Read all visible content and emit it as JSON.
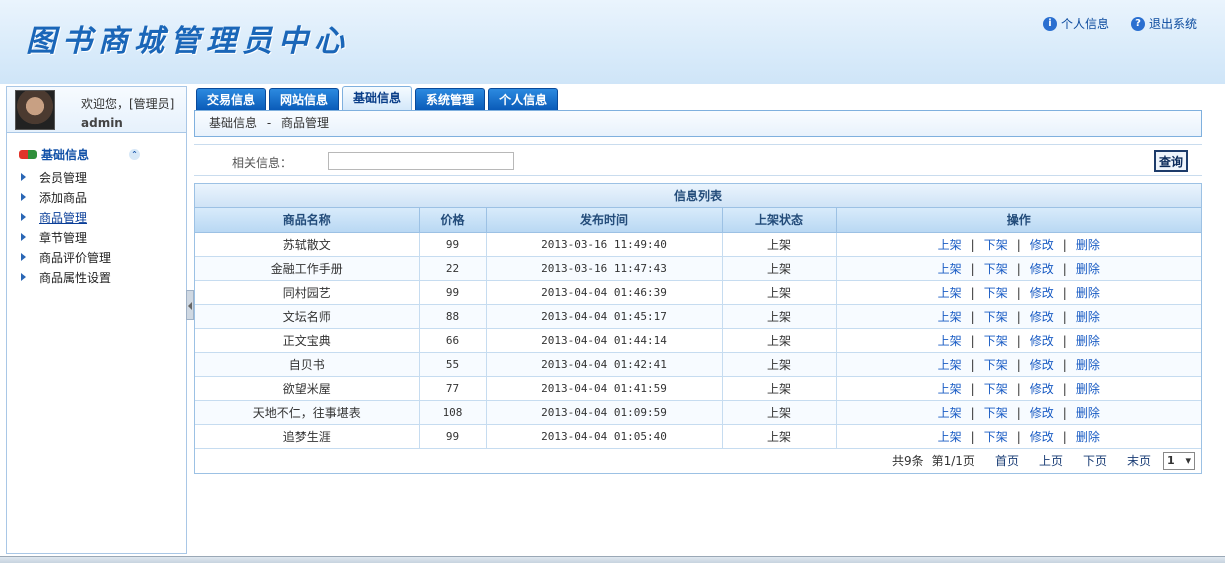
{
  "header": {
    "logo": "图书商城管理员中心",
    "links": [
      {
        "label": "个人信息",
        "icon": "info-icon"
      },
      {
        "label": "退出系统",
        "icon": "help-icon"
      }
    ]
  },
  "user": {
    "welcome": "欢迎您，[管理员]",
    "name": "admin"
  },
  "sidebar": {
    "section": "基础信息",
    "items": [
      {
        "label": "会员管理"
      },
      {
        "label": "添加商品"
      },
      {
        "label": "商品管理"
      },
      {
        "label": "章节管理"
      },
      {
        "label": "商品评价管理"
      },
      {
        "label": "商品属性设置"
      }
    ]
  },
  "tabs": [
    {
      "label": "交易信息"
    },
    {
      "label": "网站信息"
    },
    {
      "label": "基础信息"
    },
    {
      "label": "系统管理"
    },
    {
      "label": "个人信息"
    }
  ],
  "breadcrumb": {
    "a": "基础信息",
    "sep": "-",
    "b": "商品管理"
  },
  "search": {
    "label": "相关信息：",
    "value": "",
    "button": "查询"
  },
  "table": {
    "title": "信息列表",
    "headers": [
      "商品名称",
      "价格",
      "发布时间",
      "上架状态",
      "操作"
    ],
    "rows": [
      [
        "苏轼散文",
        "99",
        "2013-03-16 11:49:40",
        "上架"
      ],
      [
        "金融工作手册",
        "22",
        "2013-03-16 11:47:43",
        "上架"
      ],
      [
        "同村园艺",
        "99",
        "2013-04-04 01:46:39",
        "上架"
      ],
      [
        "文坛名师",
        "88",
        "2013-04-04 01:45:17",
        "上架"
      ],
      [
        "正文宝典",
        "66",
        "2013-04-04 01:44:14",
        "上架"
      ],
      [
        "自贝书",
        "55",
        "2013-04-04 01:42:41",
        "上架"
      ],
      [
        "欲望米屋",
        "77",
        "2013-04-04 01:41:59",
        "上架"
      ],
      [
        "天地不仁，往事堪表",
        "108",
        "2013-04-04 01:09:59",
        "上架"
      ],
      [
        "追梦生涯",
        "99",
        "2013-04-04 01:05:40",
        "上架"
      ]
    ],
    "ops": [
      "上架",
      "下架",
      "修改",
      "删除"
    ],
    "ops_sep": "|"
  },
  "pager": {
    "total": "共9条",
    "page": "第1/1页",
    "first": "首页",
    "prev": "上页",
    "next": "下页",
    "last": "末页",
    "select": "1"
  }
}
